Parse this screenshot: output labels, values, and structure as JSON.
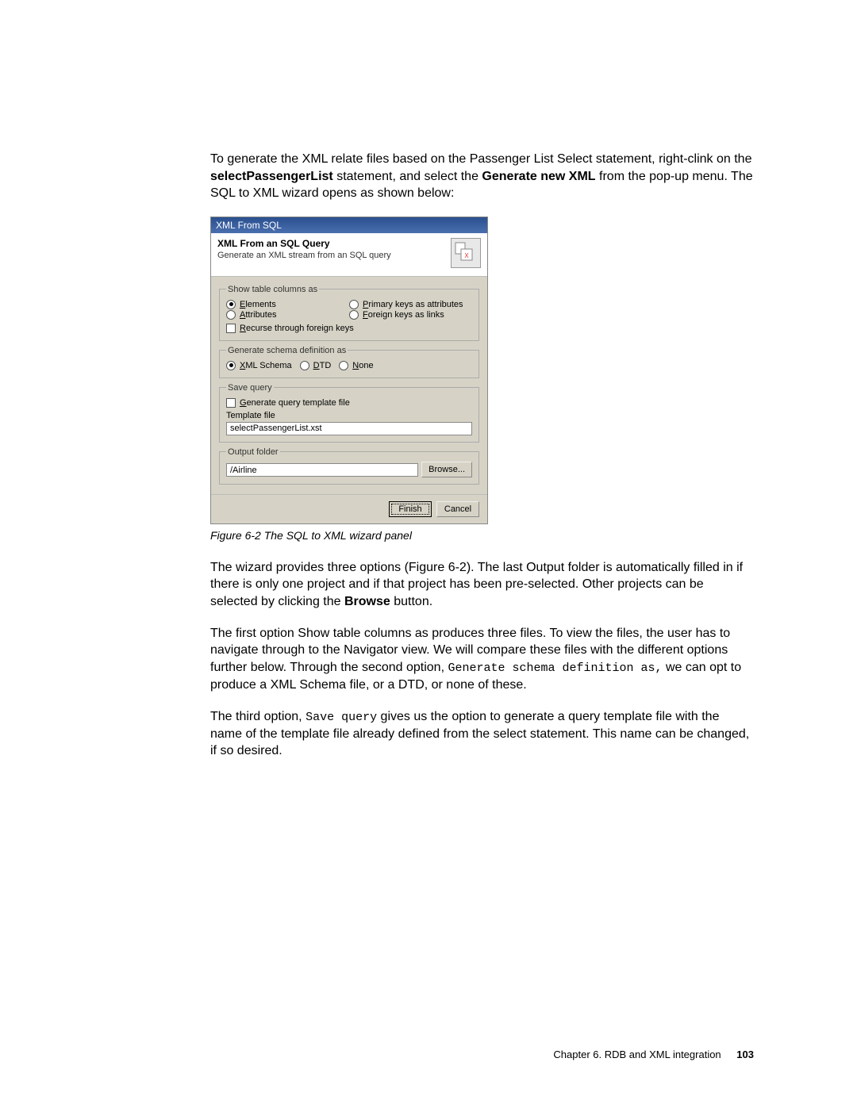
{
  "intro": {
    "line1": "To generate the XML relate files based on the Passenger List Select statement, right-clink on the ",
    "bold1": "selectPassengerList",
    "line2": " statement, and select the ",
    "bold2": "Generate new XML",
    "line3": " from the pop-up menu. The SQL to XML wizard opens as shown below:"
  },
  "dialog": {
    "title": "XML From SQL",
    "header_title": "XML From an SQL Query",
    "header_sub": "Generate an XML stream from an SQL query",
    "icon_text": "XML",
    "group1": {
      "legend": "Show table columns as",
      "elements": "Elements",
      "attributes": "Attributes",
      "primary": "Primary keys as attributes",
      "foreign": "Foreign keys as links",
      "recurse": "Recurse through foreign keys"
    },
    "group2": {
      "legend": "Generate schema definition as",
      "xml": "XML Schema",
      "dtd": "DTD",
      "none": "None"
    },
    "group3": {
      "legend": "Save query",
      "gen": "Generate query template file",
      "tpl_label": "Template file",
      "tpl_value": "selectPassengerList.xst"
    },
    "group4": {
      "legend": "Output folder",
      "value": "/Airline",
      "browse": "Browse..."
    },
    "finish": "Finish",
    "cancel": "Cancel"
  },
  "caption": "Figure 6-2   The SQL to XML wizard panel",
  "para2": {
    "t1": "The wizard provides three options (Figure 6-2). The last Output folder is automatically filled in if there is only one project and if that project has been pre-selected. Other projects can be selected by clicking the ",
    "b1": "Browse",
    "t2": " button."
  },
  "para3": {
    "t1": "The first option Show table columns as produces three files. To view the files, the user has to navigate through to the Navigator view. We will compare these files with the different options further below. Through the second option, ",
    "m1": "Generate schema definition as,",
    "t2": " we can opt to produce a XML Schema file, or a DTD, or none of these."
  },
  "para4": {
    "t1": "The third option, ",
    "m1": "Save query",
    "t2": " gives us the option to generate a query template file with the name of the template file already defined from the select statement. This name can be changed, if so desired."
  },
  "footer": {
    "chapter": "Chapter 6. RDB and XML integration",
    "page": "103"
  }
}
